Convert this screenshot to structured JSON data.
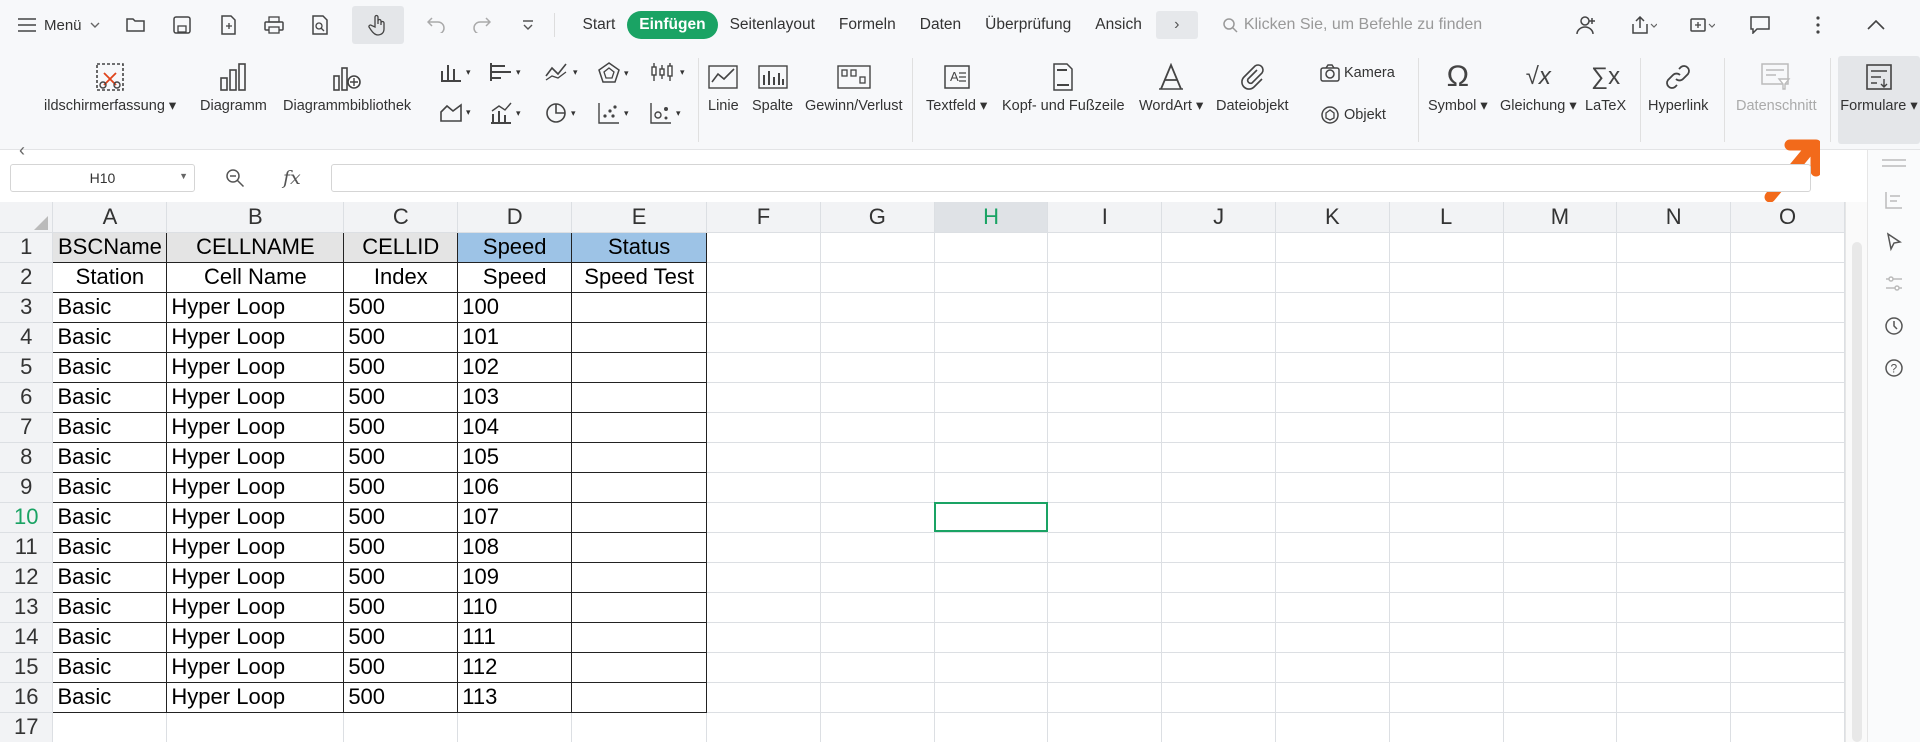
{
  "topbar": {
    "menu_label": "Menü",
    "tabs": [
      "Start",
      "Einfügen",
      "Seitenlayout",
      "Formeln",
      "Daten",
      "Überprüfung",
      "Ansich"
    ],
    "active_tab": "Einfügen",
    "search_placeholder": "Klicken Sie, um Befehle zu finden"
  },
  "ribbon": {
    "screenshot": "ildschirmerfassung",
    "chart": "Diagramm",
    "chart_library": "Diagrammbibliothek",
    "line": "Linie",
    "column": "Spalte",
    "winloss": "Gewinn/Verlust",
    "textbox": "Textfeld",
    "header_footer": "Kopf- und Fußzeile",
    "wordart": "WordArt",
    "file_object": "Dateiobjekt",
    "camera": "Kamera",
    "object": "Objekt",
    "symbol": "Symbol",
    "equation": "Gleichung",
    "latex": "LaTeX",
    "hyperlink": "Hyperlink",
    "slicer": "Datenschnitt",
    "forms": "Formulare"
  },
  "formula": {
    "namebox": "H10",
    "fx": "fx",
    "value": ""
  },
  "columns": [
    "A",
    "B",
    "C",
    "D",
    "E",
    "F",
    "G",
    "H",
    "I",
    "J",
    "K",
    "L",
    "M",
    "N",
    "O"
  ],
  "rows": [
    {
      "n": "1",
      "a": "BSCName",
      "b": "CELLNAME",
      "c": "CELLID",
      "d": "Speed",
      "e": "Status"
    },
    {
      "n": "2",
      "a": "Station",
      "b": "Cell Name",
      "c": "Index",
      "d": "Speed",
      "e": "Speed Test"
    },
    {
      "n": "3",
      "a": "Basic",
      "b": "Hyper Loop",
      "c": "500",
      "d": "100",
      "e": ""
    },
    {
      "n": "4",
      "a": "Basic",
      "b": "Hyper Loop",
      "c": "500",
      "d": "101",
      "e": ""
    },
    {
      "n": "5",
      "a": "Basic",
      "b": "Hyper Loop",
      "c": "500",
      "d": "102",
      "e": ""
    },
    {
      "n": "6",
      "a": "Basic",
      "b": "Hyper Loop",
      "c": "500",
      "d": "103",
      "e": ""
    },
    {
      "n": "7",
      "a": "Basic",
      "b": "Hyper Loop",
      "c": "500",
      "d": "104",
      "e": ""
    },
    {
      "n": "8",
      "a": "Basic",
      "b": "Hyper Loop",
      "c": "500",
      "d": "105",
      "e": ""
    },
    {
      "n": "9",
      "a": "Basic",
      "b": "Hyper Loop",
      "c": "500",
      "d": "106",
      "e": ""
    },
    {
      "n": "10",
      "a": "Basic",
      "b": "Hyper Loop",
      "c": "500",
      "d": "107",
      "e": ""
    },
    {
      "n": "11",
      "a": "Basic",
      "b": "Hyper Loop",
      "c": "500",
      "d": "108",
      "e": ""
    },
    {
      "n": "12",
      "a": "Basic",
      "b": "Hyper Loop",
      "c": "500",
      "d": "109",
      "e": ""
    },
    {
      "n": "13",
      "a": "Basic",
      "b": "Hyper Loop",
      "c": "500",
      "d": "110",
      "e": ""
    },
    {
      "n": "14",
      "a": "Basic",
      "b": "Hyper Loop",
      "c": "500",
      "d": "111",
      "e": ""
    },
    {
      "n": "15",
      "a": "Basic",
      "b": "Hyper Loop",
      "c": "500",
      "d": "112",
      "e": ""
    },
    {
      "n": "16",
      "a": "Basic",
      "b": "Hyper Loop",
      "c": "500",
      "d": "113",
      "e": ""
    },
    {
      "n": "17",
      "a": "",
      "b": "",
      "c": "",
      "d": "",
      "e": ""
    }
  ],
  "selected_cell": "H10",
  "colors": {
    "accent": "#1aa364",
    "header_gray": "#e4e4e4",
    "header_blue": "#9dc3e6",
    "arrow": "#f26a1b"
  }
}
